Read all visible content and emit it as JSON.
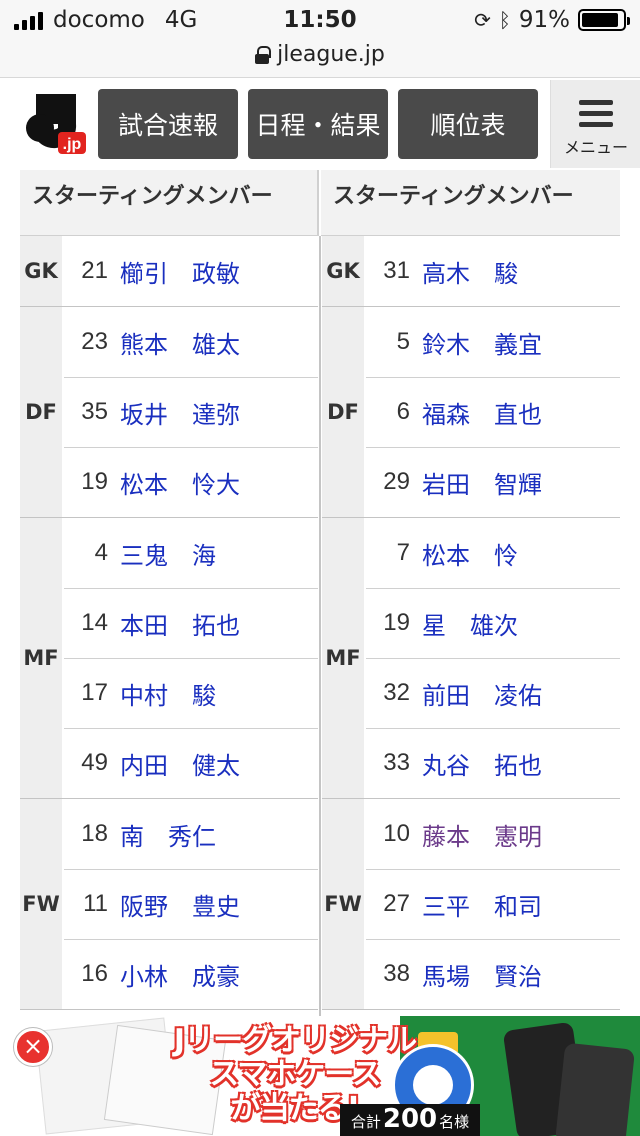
{
  "status_bar": {
    "carrier": "docomo",
    "network": "4G",
    "time": "11:50",
    "battery": "91%",
    "battery_level": 0.91
  },
  "url_bar": {
    "domain": "jleague.jp"
  },
  "header": {
    "logo_text": ".jp",
    "nav": [
      "試合速報",
      "日程・結果",
      "順位表"
    ],
    "menu_label": "メニュー"
  },
  "lineup": {
    "home": {
      "heading": "スターティングメンバー",
      "groups": [
        {
          "position": "GK",
          "players": [
            {
              "number": "21",
              "name": "櫛引　政敏"
            }
          ]
        },
        {
          "position": "DF",
          "players": [
            {
              "number": "23",
              "name": "熊本　雄太"
            },
            {
              "number": "35",
              "name": "坂井　達弥"
            },
            {
              "number": "19",
              "name": "松本　怜大"
            }
          ]
        },
        {
          "position": "MF",
          "players": [
            {
              "number": "4",
              "name": "三鬼　海"
            },
            {
              "number": "14",
              "name": "本田　拓也"
            },
            {
              "number": "17",
              "name": "中村　駿"
            },
            {
              "number": "49",
              "name": "内田　健太"
            }
          ]
        },
        {
          "position": "FW",
          "players": [
            {
              "number": "18",
              "name": "南　秀仁"
            },
            {
              "number": "11",
              "name": "阪野　豊史"
            },
            {
              "number": "16",
              "name": "小林　成豪"
            }
          ]
        }
      ]
    },
    "away": {
      "heading": "スターティングメンバー",
      "groups": [
        {
          "position": "GK",
          "players": [
            {
              "number": "31",
              "name": "高木　駿"
            }
          ]
        },
        {
          "position": "DF",
          "players": [
            {
              "number": "5",
              "name": "鈴木　義宜"
            },
            {
              "number": "6",
              "name": "福森　直也"
            },
            {
              "number": "29",
              "name": "岩田　智輝"
            }
          ]
        },
        {
          "position": "MF",
          "players": [
            {
              "number": "7",
              "name": "松本　怜"
            },
            {
              "number": "19",
              "name": "星　雄次"
            },
            {
              "number": "32",
              "name": "前田　凌佑"
            },
            {
              "number": "33",
              "name": "丸谷　拓也"
            }
          ]
        },
        {
          "position": "FW",
          "players": [
            {
              "number": "10",
              "name": "藤本　憲明",
              "visited": true
            },
            {
              "number": "27",
              "name": "三平　和司"
            },
            {
              "number": "38",
              "name": "馬場　賢治"
            }
          ]
        }
      ]
    }
  },
  "banner": {
    "close_symbol": "×",
    "line1": "Jリーグオリジナル",
    "line2": "スマホケース",
    "line3": "が当たる!",
    "total_prefix": "合計",
    "total_number": "200",
    "total_suffix": "名様"
  }
}
